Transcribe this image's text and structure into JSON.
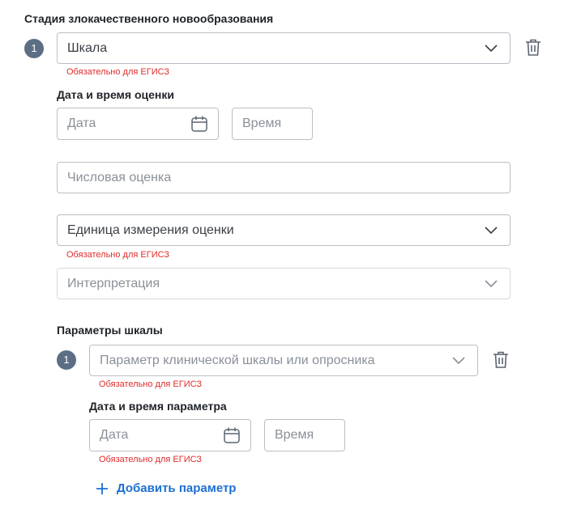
{
  "section_title": "Стадия злокачественного новообразования",
  "stage_index": "1",
  "scale": {
    "value": "Шкала"
  },
  "required_note": "Обязательно для ЕГИСЗ",
  "assessment_datetime": {
    "label": "Дата и время оценки",
    "date_placeholder": "Дата",
    "time_placeholder": "Время"
  },
  "numeric_score": {
    "placeholder": "Числовая оценка"
  },
  "unit": {
    "value": "Единица измерения оценки"
  },
  "interpretation": {
    "placeholder": "Интерпретация"
  },
  "scale_params": {
    "label": "Параметры шкалы",
    "index": "1",
    "param_placeholder": "Параметр клинической шкалы или опросника",
    "datetime_label": "Дата и время параметра",
    "date_placeholder": "Дата",
    "time_placeholder": "Время",
    "add_label": "Добавить параметр"
  },
  "colors": {
    "accent": "#1d6fd3",
    "error": "#e02b2b",
    "badge": "#5b6e84",
    "border": "#b9bec5"
  }
}
